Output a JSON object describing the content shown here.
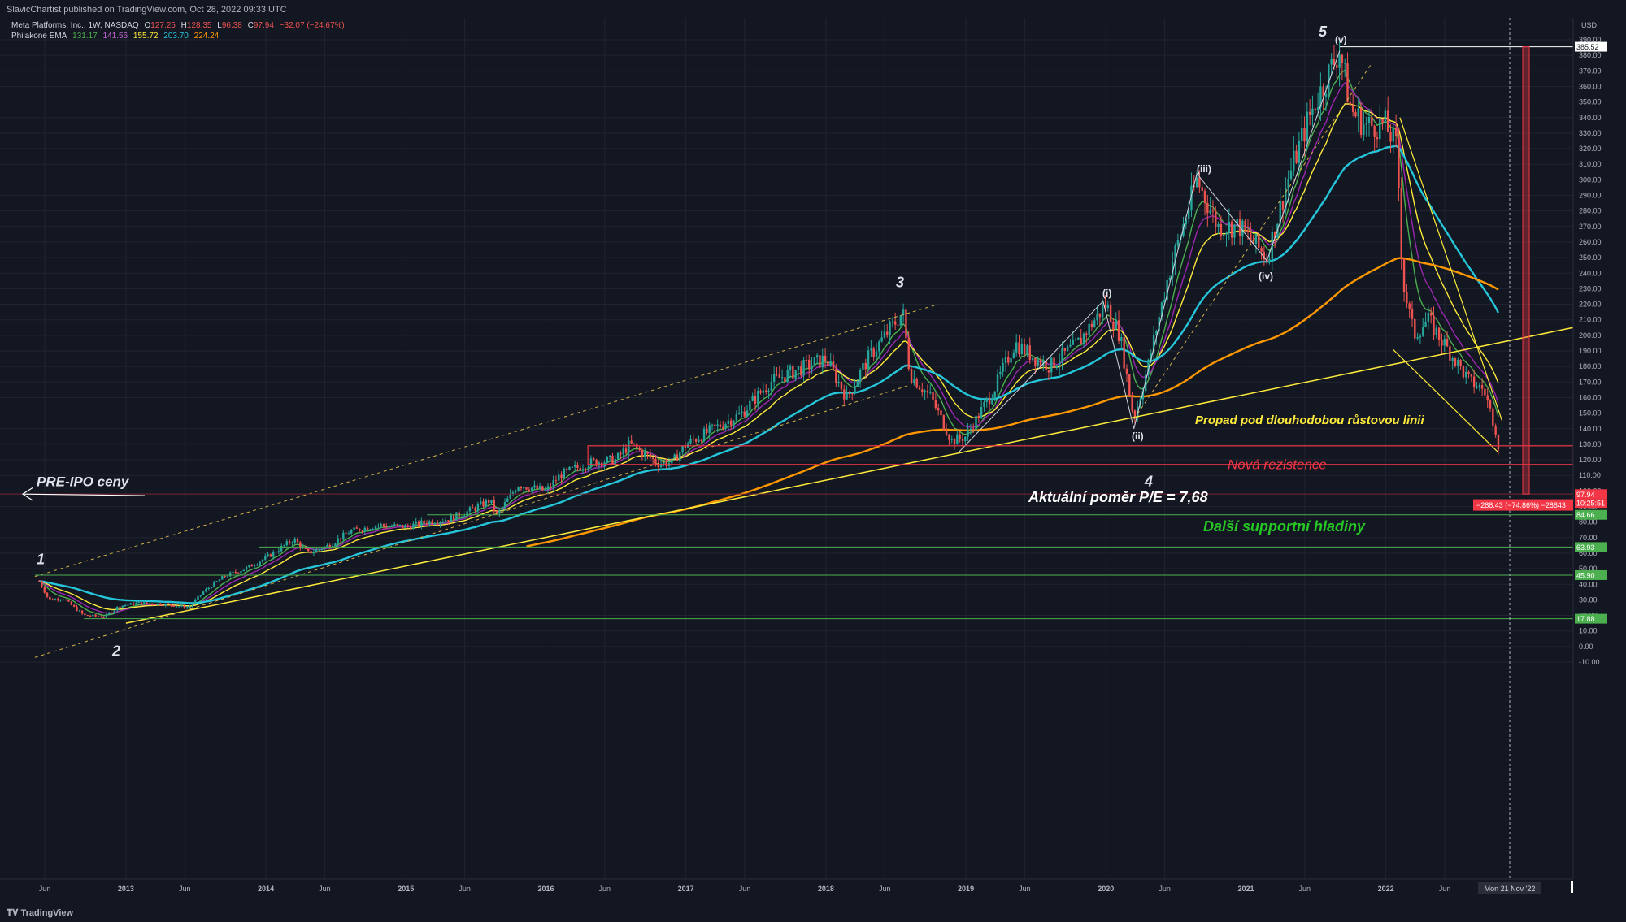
{
  "publisher_line": "SlavicChartist published on TradingView.com, Oct 28, 2022 09:33 UTC",
  "legend_main": {
    "symbol": "Meta Platforms, Inc., 1W, NASDAQ",
    "o_label": "O",
    "o_value": "127.25",
    "h_label": "H",
    "h_value": "128.35",
    "l_label": "L",
    "l_value": "96.38",
    "c_label": "C",
    "c_value": "97.94",
    "change": "−32.07 (−24.67%)"
  },
  "legend_ema": {
    "name": "Philakone EMA",
    "values": [
      "131.17",
      "141.56",
      "155.72",
      "203.70",
      "224.24"
    ]
  },
  "tradingview_label": "TradingView",
  "colors": {
    "background": "#131722",
    "grid": "#1f2430",
    "up_candle": "#26a69a",
    "down_candle": "#ef5350",
    "ema_colors": [
      "#4caf50",
      "#9c27b0",
      "#ffeb3b",
      "#26c6da",
      "#ff9800"
    ],
    "trend_yellow": "#ffeb3b",
    "resist_red": "#f23645",
    "support_green": "#4caf50"
  },
  "chart_data": {
    "type": "line",
    "title": "Meta Platforms, Inc., 1W, NASDAQ",
    "ylabel": "USD",
    "ylim": [
      -20,
      395
    ],
    "y_ticks": [
      390,
      380,
      370,
      360,
      350,
      340,
      330,
      320,
      310,
      300,
      290,
      280,
      270,
      260,
      250,
      240,
      230,
      220,
      210,
      200,
      190,
      180,
      170,
      160,
      150,
      140,
      130,
      120,
      110,
      100,
      90,
      80,
      70,
      60,
      50,
      40,
      30,
      20,
      10,
      0,
      -10
    ],
    "x_tick_labels": [
      "Jun",
      "2013",
      "Jun",
      "2014",
      "Jun",
      "2015",
      "Jun",
      "2016",
      "Jun",
      "2017",
      "Jun",
      "2018",
      "Jun",
      "2019",
      "Jun",
      "2020",
      "Jun",
      "2021",
      "Jun",
      "2022",
      "Jun"
    ],
    "x_ticks_t": [
      2012.42,
      2013.0,
      2013.42,
      2014.0,
      2014.42,
      2015.0,
      2015.42,
      2016.0,
      2016.42,
      2017.0,
      2017.42,
      2018.0,
      2018.42,
      2019.0,
      2019.42,
      2020.0,
      2020.42,
      2021.0,
      2021.42,
      2022.0,
      2022.42
    ],
    "price_path": [
      [
        2012.38,
        42
      ],
      [
        2012.45,
        30
      ],
      [
        2012.55,
        31
      ],
      [
        2012.7,
        20
      ],
      [
        2012.85,
        19
      ],
      [
        2012.95,
        26
      ],
      [
        2013.1,
        28
      ],
      [
        2013.3,
        27
      ],
      [
        2013.45,
        25
      ],
      [
        2013.55,
        35
      ],
      [
        2013.7,
        45
      ],
      [
        2013.85,
        50
      ],
      [
        2014.0,
        57
      ],
      [
        2014.2,
        69
      ],
      [
        2014.3,
        60
      ],
      [
        2014.45,
        65
      ],
      [
        2014.6,
        74
      ],
      [
        2014.8,
        78
      ],
      [
        2015.0,
        77
      ],
      [
        2015.15,
        80
      ],
      [
        2015.3,
        82
      ],
      [
        2015.45,
        87
      ],
      [
        2015.6,
        94
      ],
      [
        2015.65,
        84
      ],
      [
        2015.8,
        104
      ],
      [
        2016.0,
        100
      ],
      [
        2016.1,
        110
      ],
      [
        2016.3,
        118
      ],
      [
        2016.5,
        120
      ],
      [
        2016.6,
        130
      ],
      [
        2016.8,
        118
      ],
      [
        2016.9,
        118
      ],
      [
        2017.0,
        130
      ],
      [
        2017.2,
        140
      ],
      [
        2017.4,
        150
      ],
      [
        2017.6,
        170
      ],
      [
        2017.8,
        178
      ],
      [
        2018.0,
        185
      ],
      [
        2018.15,
        160
      ],
      [
        2018.3,
        185
      ],
      [
        2018.55,
        215
      ],
      [
        2018.6,
        175
      ],
      [
        2018.75,
        160
      ],
      [
        2018.9,
        132
      ],
      [
        2019.0,
        135
      ],
      [
        2019.2,
        165
      ],
      [
        2019.35,
        195
      ],
      [
        2019.5,
        185
      ],
      [
        2019.6,
        180
      ],
      [
        2019.8,
        195
      ],
      [
        2020.0,
        220
      ],
      [
        2020.1,
        200
      ],
      [
        2020.2,
        146
      ],
      [
        2020.3,
        180
      ],
      [
        2020.45,
        240
      ],
      [
        2020.65,
        300
      ],
      [
        2020.8,
        270
      ],
      [
        2020.95,
        270
      ],
      [
        2021.05,
        260
      ],
      [
        2021.15,
        250
      ],
      [
        2021.3,
        300
      ],
      [
        2021.45,
        340
      ],
      [
        2021.6,
        370
      ],
      [
        2021.67,
        384
      ],
      [
        2021.75,
        345
      ],
      [
        2021.85,
        335
      ],
      [
        2022.0,
        335
      ],
      [
        2022.08,
        320
      ],
      [
        2022.12,
        235
      ],
      [
        2022.2,
        200
      ],
      [
        2022.3,
        210
      ],
      [
        2022.45,
        190
      ],
      [
        2022.6,
        170
      ],
      [
        2022.7,
        165
      ],
      [
        2022.8,
        135
      ],
      [
        2022.82,
        98
      ]
    ],
    "emas": [
      {
        "name": "EMA 131.17",
        "color": "#4caf50",
        "last": 131.17
      },
      {
        "name": "EMA 141.56",
        "color": "#9c27b0",
        "last": 141.56
      },
      {
        "name": "EMA 155.72",
        "color": "#ffeb3b",
        "last": 155.72
      },
      {
        "name": "EMA 203.70",
        "color": "#26c6da",
        "last": 203.7
      },
      {
        "name": "EMA 224.24",
        "color": "#ff9800",
        "last": 224.24
      }
    ],
    "price_labels": [
      {
        "value": 385.52,
        "text": "385.52",
        "bg": "#ffffff",
        "fg": "#131722"
      },
      {
        "value": 97.94,
        "text": "97.94",
        "bg": "#f23645",
        "fg": "#ffffff"
      },
      {
        "value": 84.66,
        "text": "84.66",
        "bg": "#4caf50",
        "fg": "#ffffff"
      },
      {
        "value": 63.93,
        "text": "63.93",
        "bg": "#4caf50",
        "fg": "#ffffff"
      },
      {
        "value": 45.9,
        "text": "45.90",
        "bg": "#4caf50",
        "fg": "#ffffff"
      },
      {
        "value": 17.88,
        "text": "17.88",
        "bg": "#4caf50",
        "fg": "#ffffff"
      }
    ],
    "countdown": "10:25:51",
    "measure_label": "−288.43 (−74.86%) −28843",
    "date_label": "Mon 21 Nov '22",
    "annotations": {
      "pre_ipo": "PRE-IPO ceny",
      "pe_ratio": "Aktuální poměr P/E = 7,68",
      "breakdown": "Propad pod dlouhodobou růstovou linii",
      "new_resistance": "Nová rezistence",
      "supports": "Další supportní hladiny",
      "wave_1": "1",
      "wave_2": "2",
      "wave_3": "3",
      "wave_4": "4",
      "wave_5": "5",
      "sub_i": "(i)",
      "sub_ii": "(ii)",
      "sub_iii": "(iii)",
      "sub_iv": "(iv)",
      "sub_v": "(v)"
    },
    "support_levels": [
      84.66,
      63.93,
      45.9,
      17.88
    ],
    "resistance_levels": [
      128,
      115
    ],
    "grid": true
  }
}
